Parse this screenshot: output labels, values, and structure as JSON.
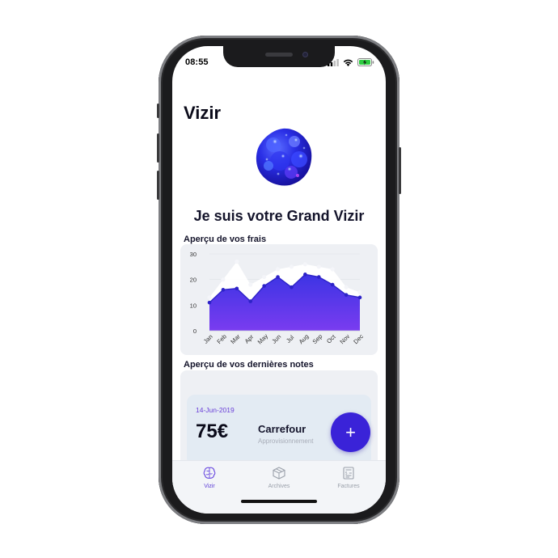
{
  "status": {
    "time": "08:55"
  },
  "app": {
    "title": "Vizir",
    "headline": "Je suis votre Grand Vizir"
  },
  "expenses": {
    "section_title": "Aperçu de vos frais"
  },
  "chart_data": {
    "type": "area",
    "title": "",
    "xlabel": "",
    "ylabel": "",
    "categories": [
      "Jan",
      "Feb",
      "Mar",
      "Apr",
      "May",
      "Jun",
      "Jul",
      "Aug",
      "Sep",
      "Oct",
      "Nov",
      "Dec"
    ],
    "ylim": [
      0,
      30
    ],
    "yticks": [
      0,
      10,
      20,
      30
    ],
    "series": [
      {
        "values": [
          11,
          16,
          16.5,
          11.5,
          17.5,
          21,
          17,
          22,
          21,
          18,
          14,
          13
        ],
        "color": "#4b2ee0"
      },
      {
        "values": [
          13,
          20,
          27,
          18,
          21,
          24,
          25,
          26,
          25,
          24,
          17,
          15
        ],
        "color": "#ffffff"
      }
    ],
    "grid": true,
    "legend": "none"
  },
  "notes": {
    "section_title": "Aperçu de vos dernières notes",
    "items": [
      {
        "date": "14-Jun-2019",
        "amount": "75€",
        "merchant": "Carrefour",
        "category": "Approvisionnement"
      }
    ],
    "add_label": "+"
  },
  "tabs": [
    {
      "label": "Vizir",
      "icon": "brain-icon",
      "active": true
    },
    {
      "label": "Archives",
      "icon": "archive-box-icon",
      "active": false
    },
    {
      "label": "Factures",
      "icon": "invoice-icon",
      "active": false
    }
  ],
  "colors": {
    "accent": "#3a23d8",
    "card": "#eef0f4",
    "text": "#14142b"
  }
}
